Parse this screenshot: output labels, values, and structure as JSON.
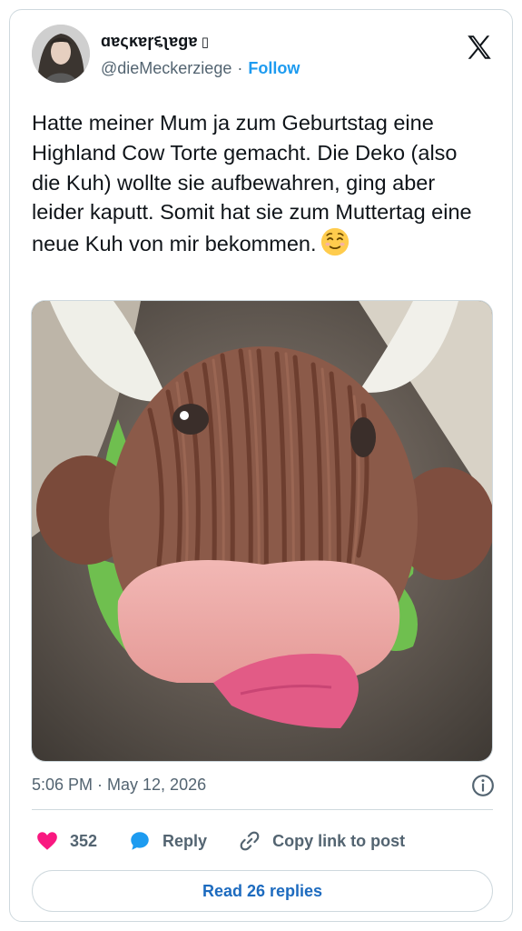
{
  "author": {
    "display_name": "ɑɐςĸɐɼ૬ʅɐɡɐ",
    "name_suffix_glyph": "⁣",
    "handle": "@dieMeckerziege",
    "separator": "·",
    "follow_label": "Follow"
  },
  "tweet": {
    "text": "Hatte meiner Mum ja zum Geburtstag eine Highland Cow Torte gemacht. Die Deko (also die Kuh) wollte sie aufbewahren, ging aber leider kaputt. Somit hat sie zum Muttertag eine neue Kuh von mir bekommen.",
    "emoji": "relieved-face-emoji",
    "timestamp": "5:06 PM · May 12, 2026"
  },
  "actions": {
    "like_count": "352",
    "reply_label": "Reply",
    "copy_label": "Copy link to post"
  },
  "footer": {
    "read_replies_label": "Read 26 replies"
  },
  "colors": {
    "accent": "#1d9bf0",
    "like": "#f91880",
    "muted": "#536471",
    "border": "#cfd9de"
  },
  "icons": [
    "x-logo-icon",
    "info-icon",
    "heart-icon",
    "reply-bubble-icon",
    "link-icon"
  ]
}
